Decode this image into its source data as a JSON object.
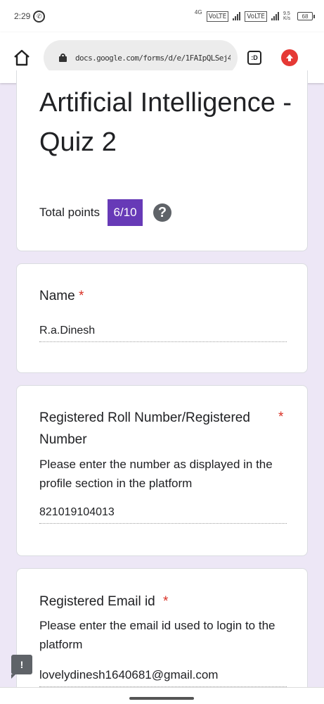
{
  "status_bar": {
    "time": "2:29",
    "network_type": "4G",
    "volte1": "VoLTE",
    "volte2": "VoLTE",
    "data_rate": "9.5 K/s",
    "battery": "68",
    "icons": [
      "whatsapp-icon",
      "signal-icon",
      "battery-icon"
    ]
  },
  "browser": {
    "url": "docs.google.com/forms/d/e/1FAIpQLSej4;",
    "tabs_label": ":D",
    "icons": [
      "home-icon",
      "lock-icon",
      "tabs-icon",
      "upload-icon"
    ]
  },
  "form": {
    "title": "Artificial Intelligence - Quiz 2",
    "points_label": "Total points",
    "points_value": "6/10",
    "help_glyph": "?",
    "accent_color": "#673ab7"
  },
  "questions": [
    {
      "label": "Name",
      "required_mark": "*",
      "description": "",
      "answer": "R.a.Dinesh"
    },
    {
      "label": "Registered Roll Number/Registered Number",
      "required_mark": "*",
      "description": "Please enter the number as displayed in the profile section in the platform",
      "answer": "821019104013"
    },
    {
      "label": "Registered Email id",
      "required_mark": "*",
      "description": "Please enter the email id used to login to the platform",
      "answer": "lovelydinesh1640681@gmail.com"
    }
  ],
  "feedback_glyph": "!"
}
